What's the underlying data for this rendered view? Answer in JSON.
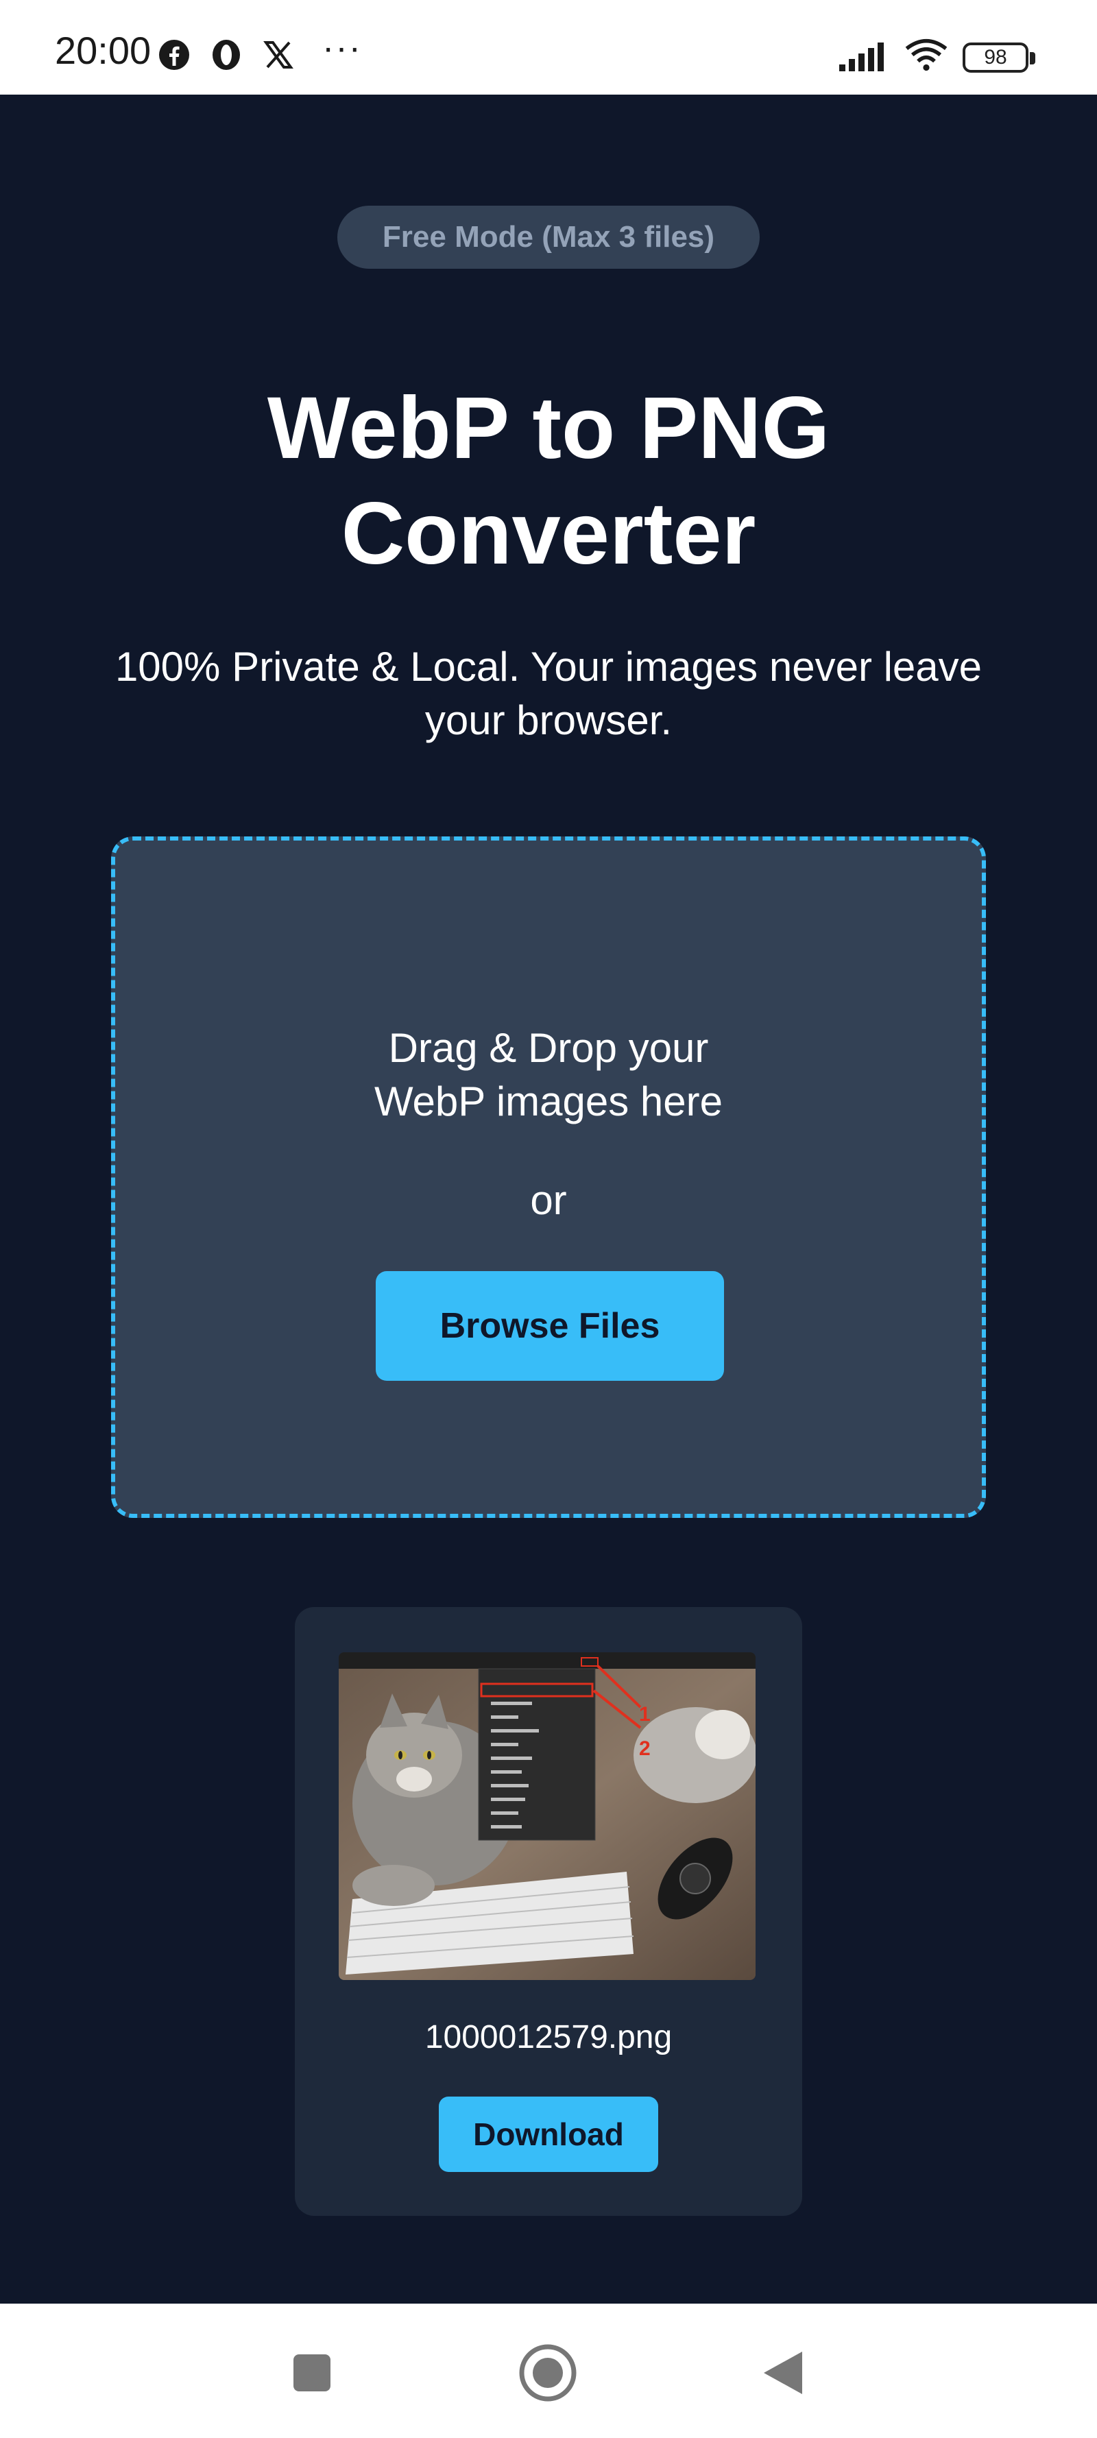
{
  "status_bar": {
    "time": "20:00",
    "notification_icons": [
      "facebook-icon",
      "opera-icon",
      "x-icon"
    ],
    "more": "···",
    "battery": "98",
    "signal_icon": "signal-icon",
    "wifi_icon": "wifi-icon"
  },
  "main": {
    "mode_badge": "Free Mode (Max 3 files)",
    "title": "WebP to PNG Converter",
    "subtitle": "100% Private & Local. Your images never leave your browser.",
    "dropzone": {
      "drag_text": "Drag & Drop your WebP images here",
      "or_text": "or",
      "browse_label": "Browse Files"
    },
    "result": {
      "file_name": "1000012579.png",
      "download_label": "Download"
    }
  },
  "nav_bar": {
    "buttons": [
      "recents-icon",
      "home-icon",
      "back-icon"
    ]
  },
  "colors": {
    "background": "#0f172a",
    "panel": "#334155",
    "card": "#1e293b",
    "accent": "#38bdf8",
    "badge_text": "#94a3b8"
  }
}
